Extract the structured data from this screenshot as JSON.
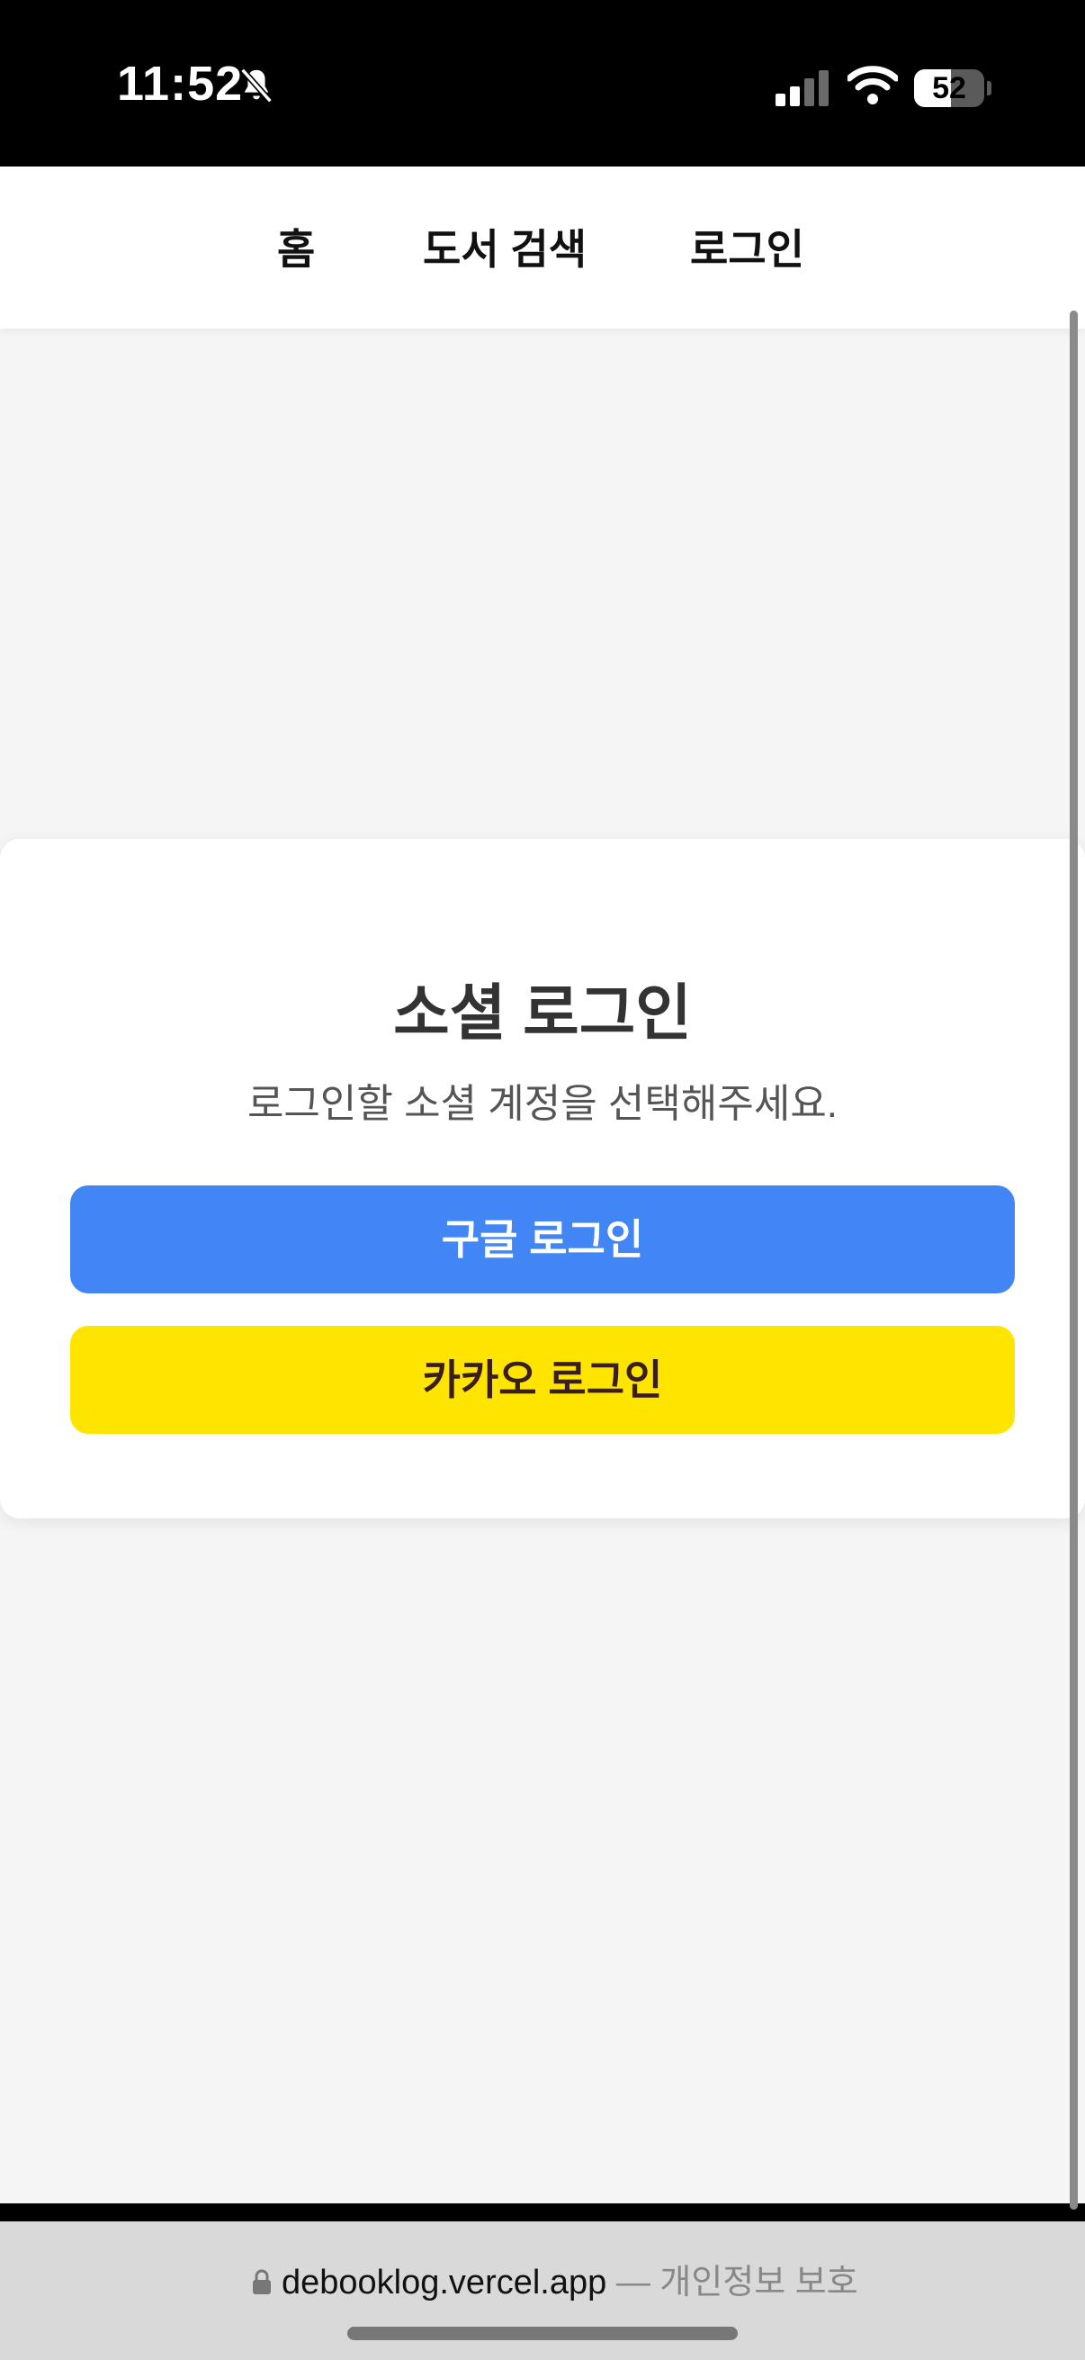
{
  "status": {
    "time": "11:52",
    "battery": "52",
    "battery_level": 0.52
  },
  "nav": {
    "home": "홈",
    "search": "도서 검색",
    "login": "로그인"
  },
  "login_card": {
    "title": "소셜 로그인",
    "subtitle": "로그인할 소셜 계정을 선택해주세요.",
    "google_label": "구글 로그인",
    "kakao_label": "카카오 로그인"
  },
  "browser": {
    "url": "debooklog.vercel.app",
    "separator": "—",
    "privacy": "개인정보 보호"
  },
  "colors": {
    "google": "#4285f4",
    "kakao": "#fee500",
    "kakao_text": "#3a1d1d"
  },
  "icons": [
    "bell-slash-icon",
    "cellular-signal-icon",
    "wifi-icon",
    "battery-icon",
    "lock-icon"
  ]
}
